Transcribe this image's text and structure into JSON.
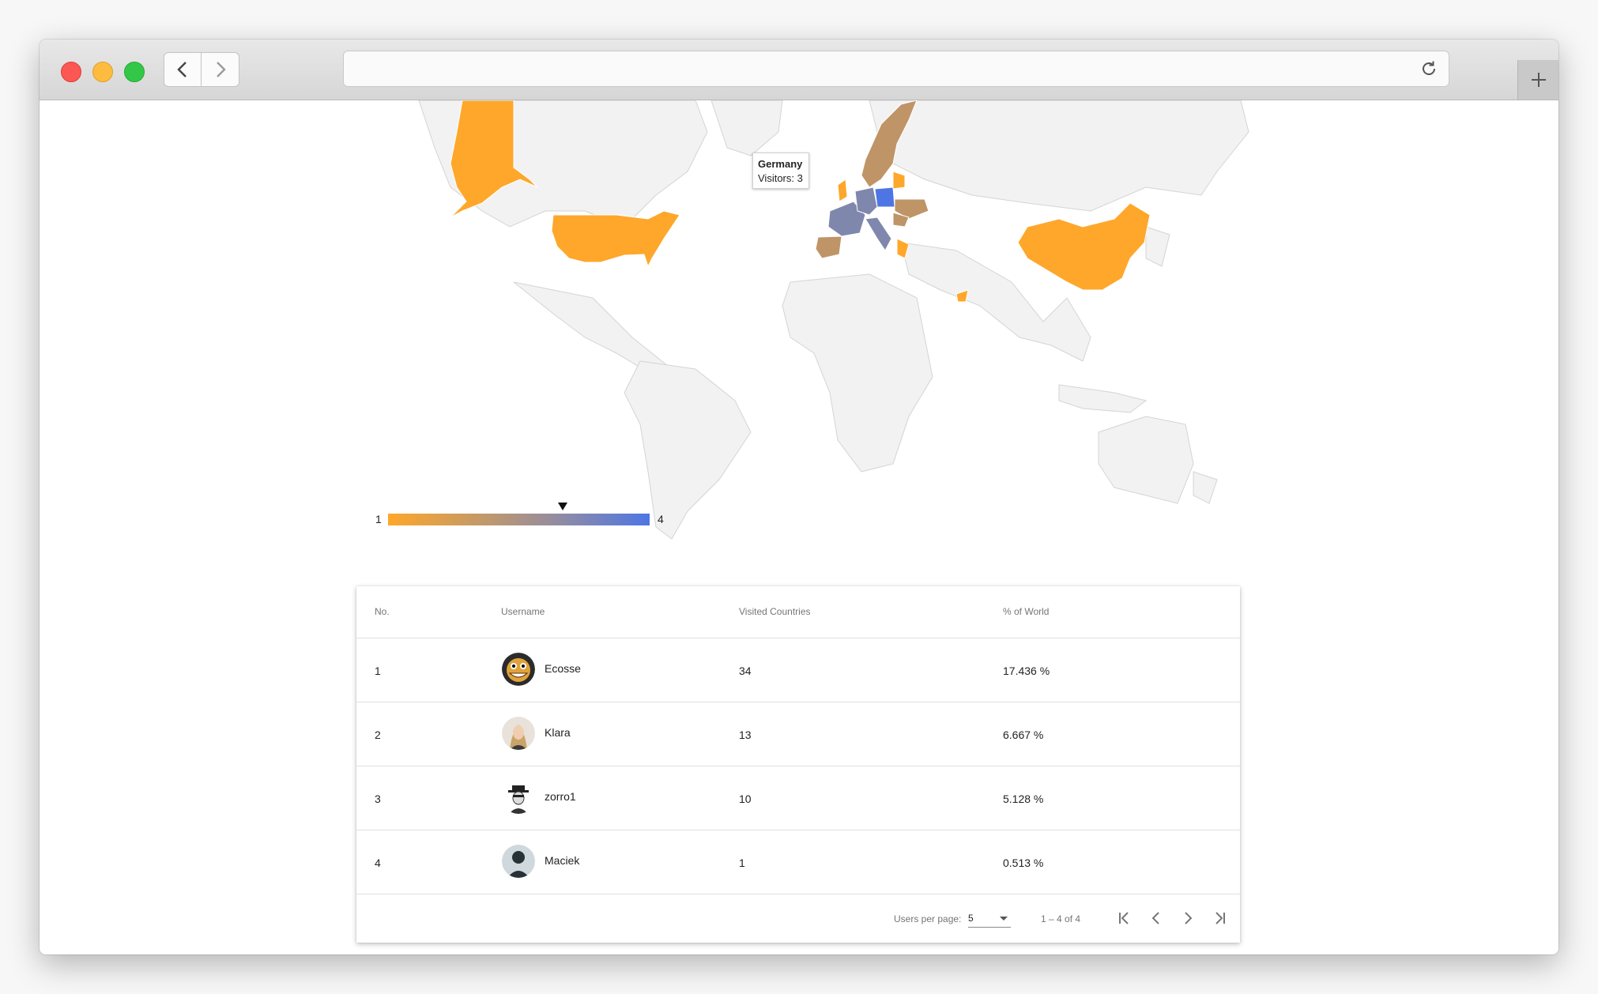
{
  "browser": {
    "url": ""
  },
  "map": {
    "tooltip": {
      "country": "Germany",
      "label": "Visitors: 3"
    },
    "legend": {
      "min": "1",
      "max": "4",
      "marker_value": 3
    },
    "colors": {
      "low": "#fea72a",
      "mid": "#c0956b",
      "high": "#4d76e4",
      "land": "#f2f2f2"
    },
    "highlighted_countries": [
      {
        "name": "United States",
        "color": "#fea72a"
      },
      {
        "name": "Alaska (United States)",
        "color": "#fea72a"
      },
      {
        "name": "China",
        "color": "#fea72a"
      },
      {
        "name": "Norway",
        "color": "#bf9467"
      },
      {
        "name": "Sweden",
        "color": "#bf9467"
      },
      {
        "name": "Germany",
        "color": "#7f87ad"
      },
      {
        "name": "France",
        "color": "#7f87ad"
      },
      {
        "name": "Italy",
        "color": "#7f87ad"
      },
      {
        "name": "Poland",
        "color": "#4d76e4"
      },
      {
        "name": "Spain",
        "color": "#bf9467"
      },
      {
        "name": "Ukraine",
        "color": "#bf9467"
      },
      {
        "name": "Romania",
        "color": "#bf9467"
      },
      {
        "name": "Baltics",
        "color": "#fea72a"
      },
      {
        "name": "Greece",
        "color": "#fea72a"
      },
      {
        "name": "United Kingdom",
        "color": "#fea72a"
      },
      {
        "name": "United Arab Emirates",
        "color": "#fea72a"
      }
    ]
  },
  "table": {
    "headers": [
      "No.",
      "Username",
      "Visited Countries",
      "% of World"
    ],
    "rows": [
      {
        "no": "1",
        "username": "Ecosse",
        "visited": "34",
        "percent": "17.436 %"
      },
      {
        "no": "2",
        "username": "Klara",
        "visited": "13",
        "percent": "6.667 %"
      },
      {
        "no": "3",
        "username": "zorro1",
        "visited": "10",
        "percent": "5.128 %"
      },
      {
        "no": "4",
        "username": "Maciek",
        "visited": "1",
        "percent": "0.513 %"
      }
    ],
    "footer": {
      "per_page_label": "Users per page:",
      "per_page_value": "5",
      "range": "1 – 4 of 4"
    }
  }
}
